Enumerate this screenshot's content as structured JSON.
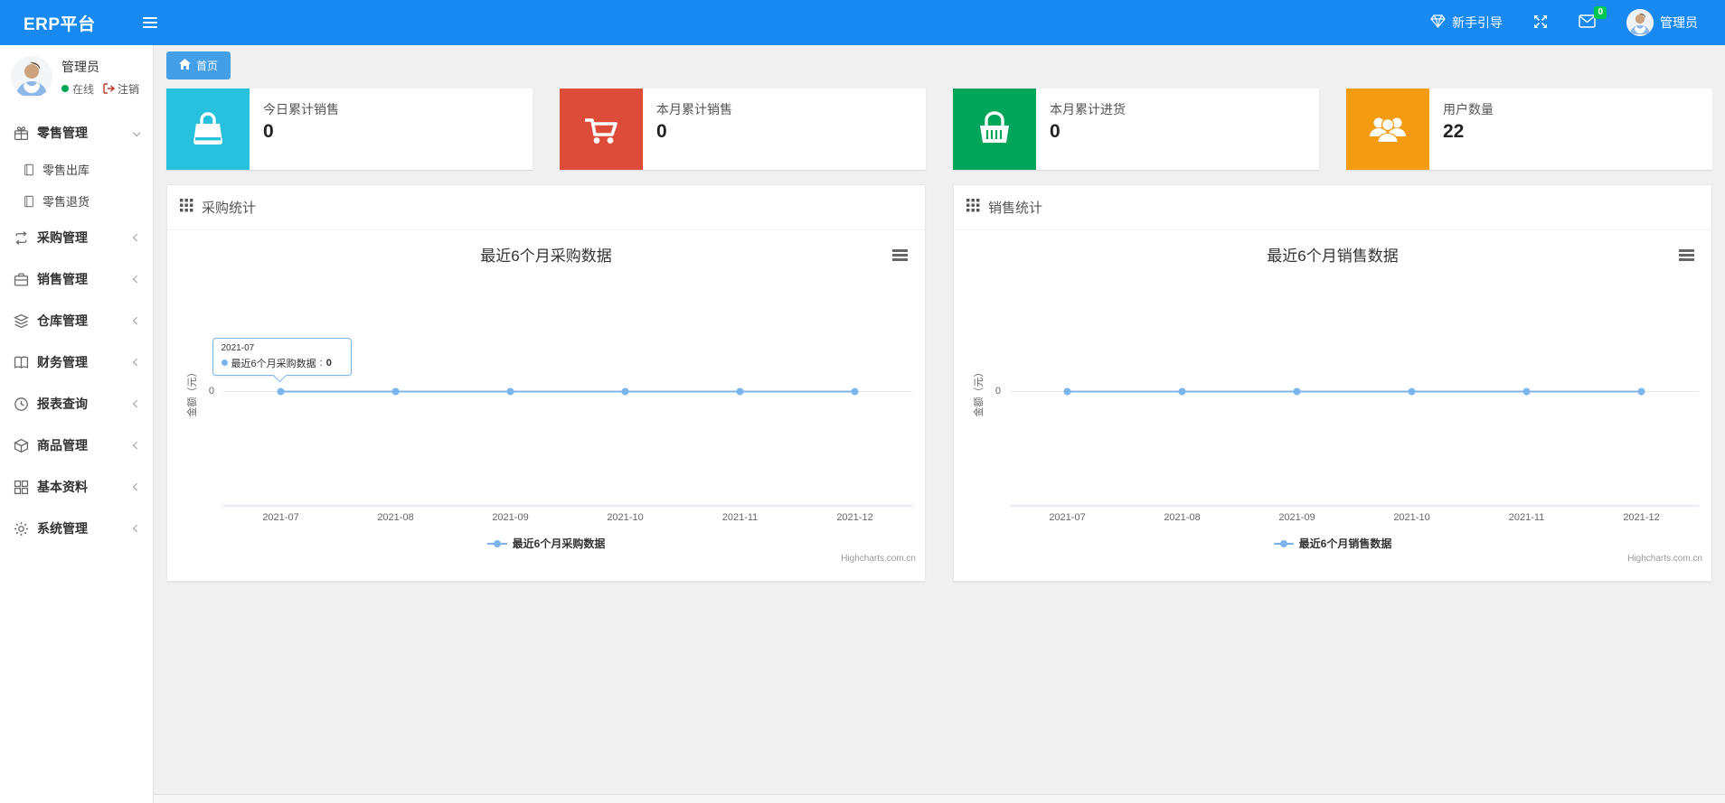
{
  "navbar": {
    "brand": "ERP平台",
    "guide_label": "新手引导",
    "mail_badge": "0",
    "user_name": "管理员"
  },
  "sidebar": {
    "user": {
      "name": "管理员",
      "status": "在线",
      "logout_label": "注销"
    },
    "menu": [
      {
        "label": "零售管理",
        "icon": "gift-icon",
        "state": "expanded",
        "children": [
          {
            "label": "零售出库",
            "icon": "journal-icon"
          },
          {
            "label": "零售退货",
            "icon": "journal-icon"
          }
        ]
      },
      {
        "label": "采购管理",
        "icon": "loop-icon",
        "state": "collapsed"
      },
      {
        "label": "销售管理",
        "icon": "briefcase-icon",
        "state": "collapsed"
      },
      {
        "label": "仓库管理",
        "icon": "layers-icon",
        "state": "collapsed"
      },
      {
        "label": "财务管理",
        "icon": "book-icon",
        "state": "collapsed"
      },
      {
        "label": "报表查询",
        "icon": "clock-icon",
        "state": "collapsed"
      },
      {
        "label": "商品管理",
        "icon": "package-icon",
        "state": "collapsed"
      },
      {
        "label": "基本资料",
        "icon": "grid-icon",
        "state": "collapsed"
      },
      {
        "label": "系统管理",
        "icon": "gear-icon",
        "state": "collapsed"
      }
    ]
  },
  "tabs": [
    {
      "label": "首页",
      "icon": "home-icon",
      "active": true
    }
  ],
  "stat_cards": [
    {
      "label": "今日累计销售",
      "value": "0",
      "icon": "shopping-bag-icon",
      "color": "#27c1dd"
    },
    {
      "label": "本月累计销售",
      "value": "0",
      "icon": "shopping-cart-icon",
      "color": "#dd4b39"
    },
    {
      "label": "本月累计进货",
      "value": "0",
      "icon": "shopping-basket-icon",
      "color": "#00a65a"
    },
    {
      "label": "用户数量",
      "value": "22",
      "icon": "users-icon",
      "color": "#f39c12"
    }
  ],
  "panels": [
    {
      "title": "采购统计"
    },
    {
      "title": "销售统计"
    }
  ],
  "chart_data": [
    {
      "type": "line",
      "title": "最近6个月采购数据",
      "categories": [
        "2021-07",
        "2021-08",
        "2021-09",
        "2021-10",
        "2021-11",
        "2021-12"
      ],
      "series": [
        {
          "name": "最近6个月采购数据",
          "values": [
            0,
            0,
            0,
            0,
            0,
            0
          ],
          "color": "#7cb5ec"
        }
      ],
      "ylabel": "金额（元）",
      "ylim": [
        -1,
        1
      ],
      "yticks": [
        "0"
      ],
      "grid": true,
      "legend_position": "bottom-center",
      "credits": "Highcharts.com.cn",
      "tooltip": {
        "x": "2021-07",
        "series": "最近6个月采购数据",
        "separator": ": ",
        "value": "0",
        "point_index": 0
      }
    },
    {
      "type": "line",
      "title": "最近6个月销售数据",
      "categories": [
        "2021-07",
        "2021-08",
        "2021-09",
        "2021-10",
        "2021-11",
        "2021-12"
      ],
      "series": [
        {
          "name": "最近6个月销售数据",
          "values": [
            0,
            0,
            0,
            0,
            0,
            0
          ],
          "color": "#7cb5ec"
        }
      ],
      "ylabel": "金额（元）",
      "ylim": [
        -1,
        1
      ],
      "yticks": [
        "0"
      ],
      "grid": true,
      "legend_position": "bottom-center",
      "credits": "Highcharts.com.cn"
    }
  ]
}
